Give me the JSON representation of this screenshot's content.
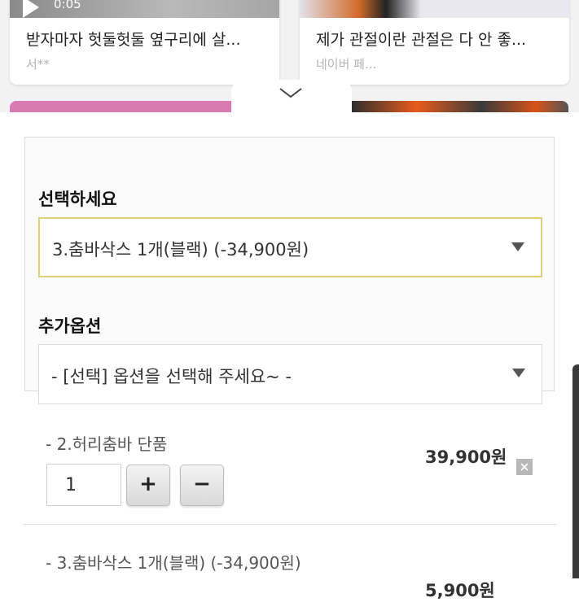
{
  "review_cards": [
    {
      "video_time": "0:05",
      "title": "받자마자 헛둘헛둘 옆구리에 살...",
      "author": "서**"
    },
    {
      "title": "제가 관절이란 관절은 다 안 좋...",
      "author": "네이버 페..."
    }
  ],
  "option_panel": {
    "select_label": "선택하세요",
    "selected_value": "3.춤바삭스 1개(블랙) (-34,900원)",
    "addon_label": "추가옵션",
    "addon_value": "- [선택] 옵션을 선택해 주세요~ -"
  },
  "items": [
    {
      "name": "- 2.허리춤바 단품",
      "quantity": "1",
      "plus": "+",
      "minus": "−",
      "price": "39,900원"
    },
    {
      "name": "- 3.춤바삭스 1개(블랙) (-34,900원)",
      "price": "5,900원"
    }
  ],
  "colors": {
    "selected_border": "#e4cd7a",
    "remove_button": "#b8b8b8"
  },
  "icons": [
    "play-icon",
    "chevron-down-icon",
    "dropdown-arrow-icon",
    "close-icon"
  ]
}
